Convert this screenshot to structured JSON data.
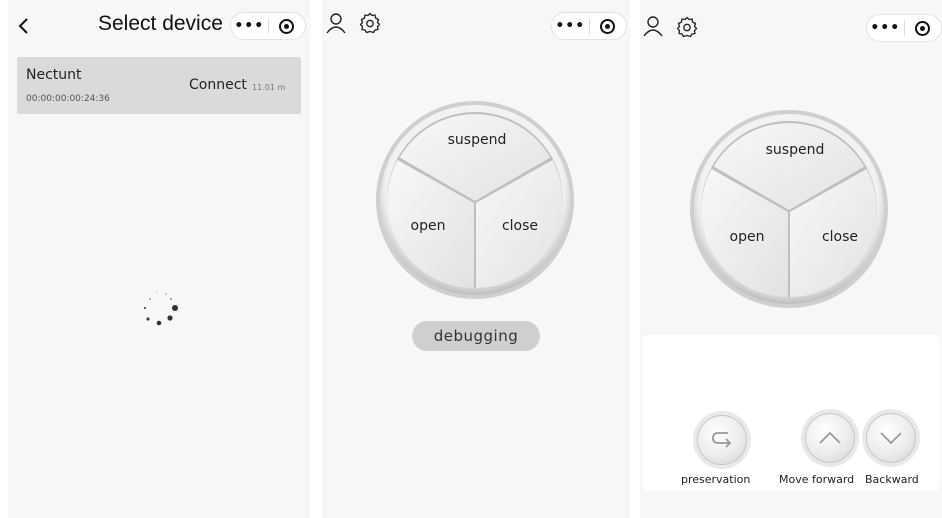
{
  "screen1": {
    "title": "Select device",
    "device": {
      "name": "Nectunt",
      "mac": "00:00:00:00:24:36",
      "action": "Connect",
      "distance": "11.01 m"
    }
  },
  "screen2": {
    "wheel": {
      "top": "suspend",
      "left": "open",
      "right": "close"
    },
    "debug_label": "debugging"
  },
  "screen3": {
    "wheel": {
      "top": "suspend",
      "left": "open",
      "right": "close"
    },
    "controls": {
      "preservation": "preservation",
      "forward": "Move forward",
      "backward": "Backward"
    }
  },
  "colors": {
    "panel_bg": "#f7f7f7",
    "device_row": "#dadada",
    "button_grey": "#cfcfcf"
  }
}
